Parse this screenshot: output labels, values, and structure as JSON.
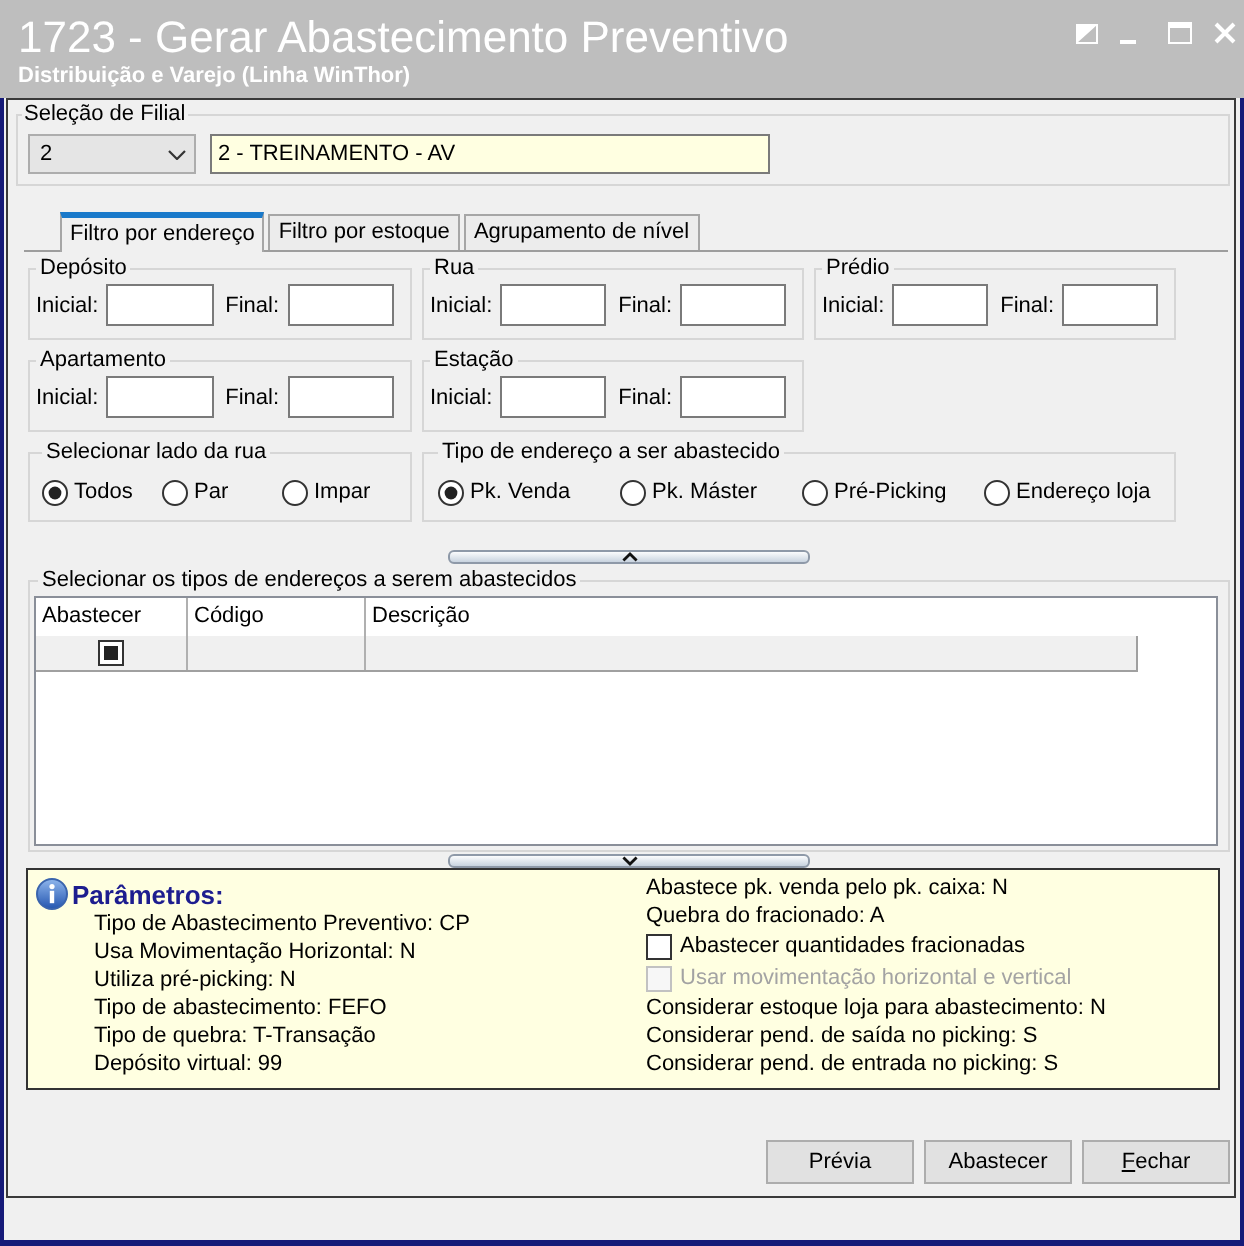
{
  "window": {
    "title": "1723 - Gerar Abastecimento Preventivo",
    "subtitle": "Distribuição e Varejo (Linha WinThor)"
  },
  "branch_selection": {
    "label": "Seleção de Filial",
    "code": "2",
    "name": "2 - TREINAMENTO - AV"
  },
  "tabs": [
    {
      "label": "Filtro por endereço",
      "selected": true
    },
    {
      "label": "Filtro por estoque",
      "selected": false
    },
    {
      "label": "Agrupamento de nível",
      "selected": false
    }
  ],
  "range_filters": [
    {
      "label": "Depósito",
      "start_label": "Inicial:",
      "end_label": "Final:"
    },
    {
      "label": "Rua",
      "start_label": "Inicial:",
      "end_label": "Final:"
    },
    {
      "label": "Prédio",
      "start_label": "Inicial:",
      "end_label": "Final:"
    },
    {
      "label": "Apartamento",
      "start_label": "Inicial:",
      "end_label": "Final:"
    },
    {
      "label": "Estação",
      "start_label": "Inicial:",
      "end_label": "Final:"
    }
  ],
  "street_side": {
    "label": "Selecionar lado da rua",
    "options": [
      {
        "label": "Todos",
        "selected": true
      },
      {
        "label": "Par",
        "selected": false
      },
      {
        "label": "Impar",
        "selected": false
      }
    ]
  },
  "address_type": {
    "label": "Tipo de endereço a ser abastecido",
    "options": [
      {
        "label": "Pk. Venda",
        "selected": true
      },
      {
        "label": "Pk. Máster",
        "selected": false
      },
      {
        "label": "Pré-Picking",
        "selected": false
      },
      {
        "label": "Endereço loja",
        "selected": false
      }
    ]
  },
  "address_types_table": {
    "label": "Selecionar os tipos de endereços a serem abastecidos",
    "columns": [
      "Abastecer",
      "Código",
      "Descrição"
    ],
    "rows": [
      {
        "checked": true
      }
    ]
  },
  "parameters": {
    "title": "Parâmetros:",
    "left": [
      "Tipo de Abastecimento Preventivo: CP",
      "Usa Movimentação Horizontal: N",
      "Utiliza pré-picking: N",
      "Tipo de abastecimento: FEFO",
      "Tipo de quebra: T-Transação",
      "Depósito virtual: 99"
    ],
    "right": [
      {
        "kind": "text",
        "text": "Abastece pk. venda pelo pk. caixa: N"
      },
      {
        "kind": "text",
        "text": "Quebra do fracionado: A"
      },
      {
        "kind": "checkbox",
        "label": "Abastecer quantidades fracionadas",
        "checked": false,
        "disabled": false
      },
      {
        "kind": "checkbox",
        "label": "Usar movimentação horizontal e vertical",
        "checked": false,
        "disabled": true
      },
      {
        "kind": "text",
        "text": "Considerar estoque loja para abastecimento: N"
      },
      {
        "kind": "text",
        "text": "Considerar pend. de saída no picking: S"
      },
      {
        "kind": "text",
        "text": "Considerar pend. de entrada no picking: S"
      }
    ]
  },
  "buttons": [
    {
      "label": "Prévia",
      "mnemonic": false
    },
    {
      "label": "Abastecer",
      "mnemonic": false
    },
    {
      "label": "Fechar",
      "mnemonic": true
    }
  ]
}
